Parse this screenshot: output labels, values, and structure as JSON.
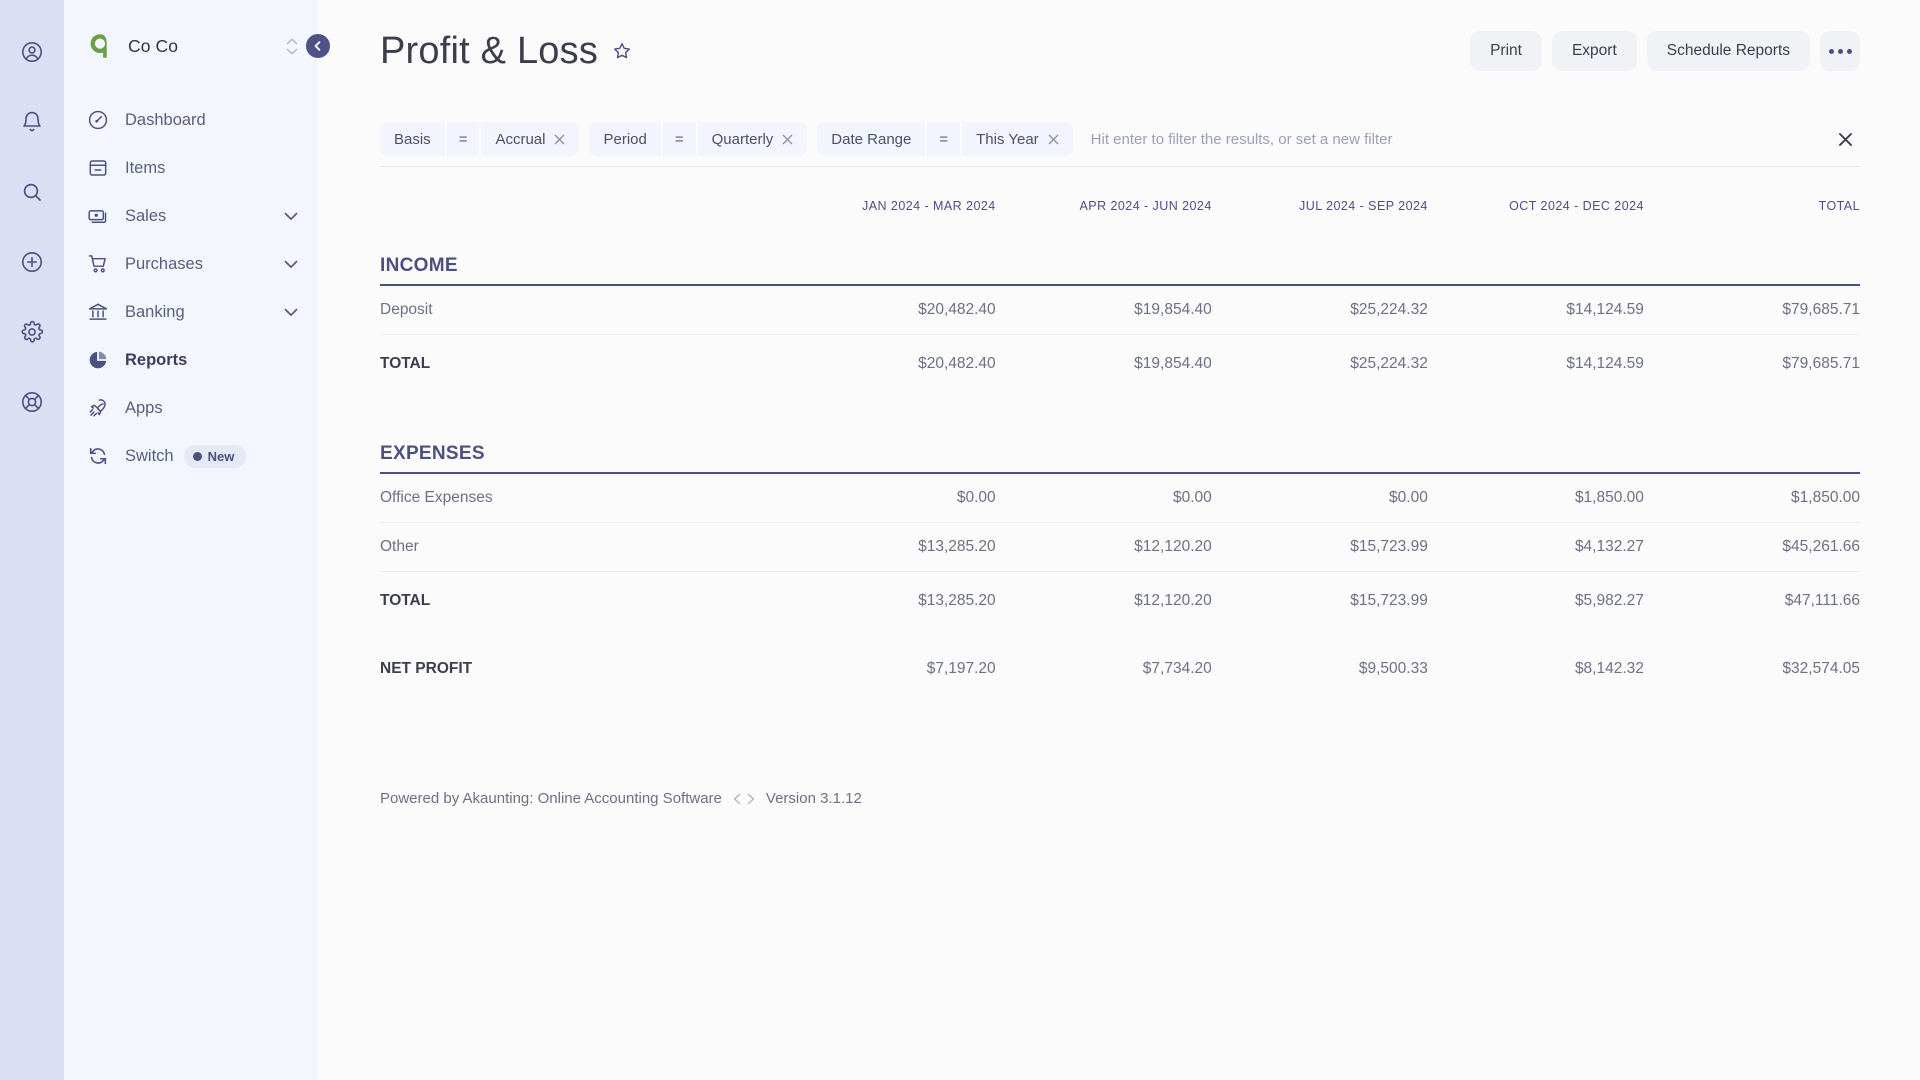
{
  "icon_rail": [
    {
      "name": "account-icon",
      "label": "Account"
    },
    {
      "name": "notifications-icon",
      "label": "Notifications"
    },
    {
      "name": "search-icon",
      "label": "Search"
    },
    {
      "name": "create-new-icon",
      "label": "Create New"
    },
    {
      "name": "settings-icon",
      "label": "Settings"
    },
    {
      "name": "help-icon",
      "label": "Help"
    }
  ],
  "sidebar": {
    "company_name": "Co Co",
    "logo_color": "#6a9f45",
    "items": [
      {
        "label": "Dashboard",
        "icon": "dashboard-icon",
        "expandable": false,
        "active": false
      },
      {
        "label": "Items",
        "icon": "items-icon",
        "expandable": false,
        "active": false
      },
      {
        "label": "Sales",
        "icon": "sales-icon",
        "expandable": true,
        "active": false
      },
      {
        "label": "Purchases",
        "icon": "purchases-icon",
        "expandable": true,
        "active": false
      },
      {
        "label": "Banking",
        "icon": "banking-icon",
        "expandable": true,
        "active": false
      },
      {
        "label": "Reports",
        "icon": "reports-icon",
        "expandable": false,
        "active": true
      },
      {
        "label": "Apps",
        "icon": "apps-icon",
        "expandable": false,
        "active": false
      },
      {
        "label": "Switch",
        "icon": "switch-icon",
        "expandable": false,
        "active": false,
        "badge": "New"
      }
    ]
  },
  "header": {
    "title": "Profit & Loss",
    "favorite_icon": "star-icon",
    "buttons": {
      "print": "Print",
      "export": "Export",
      "schedule_reports": "Schedule Reports",
      "more": "•••"
    }
  },
  "filters": {
    "chips": [
      {
        "field": "Basis",
        "operator": "=",
        "value": "Accrual"
      },
      {
        "field": "Period",
        "operator": "=",
        "value": "Quarterly"
      },
      {
        "field": "Date Range",
        "operator": "=",
        "value": "This Year"
      }
    ],
    "input_value": "",
    "placeholder": "Hit enter to filter the results, or set a new filter",
    "clear_label": "×"
  },
  "report": {
    "columns": [
      "",
      "JAN 2024 - MAR 2024",
      "APR 2024 - JUN 2024",
      "JUL 2024 - SEP 2024",
      "OCT 2024 - DEC 2024",
      "TOTAL"
    ],
    "sections": [
      {
        "title": "INCOME",
        "rows": [
          {
            "name": "Deposit",
            "values": [
              "$20,482.40",
              "$19,854.40",
              "$25,224.32",
              "$14,124.59",
              "$79,685.71"
            ]
          }
        ],
        "total": {
          "name": "TOTAL",
          "values": [
            "$20,482.40",
            "$19,854.40",
            "$25,224.32",
            "$14,124.59",
            "$79,685.71"
          ]
        }
      },
      {
        "title": "EXPENSES",
        "rows": [
          {
            "name": "Office Expenses",
            "values": [
              "$0.00",
              "$0.00",
              "$0.00",
              "$1,850.00",
              "$1,850.00"
            ]
          },
          {
            "name": "Other",
            "values": [
              "$13,285.20",
              "$12,120.20",
              "$15,723.99",
              "$4,132.27",
              "$45,261.66"
            ]
          }
        ],
        "total": {
          "name": "TOTAL",
          "values": [
            "$13,285.20",
            "$12,120.20",
            "$15,723.99",
            "$5,982.27",
            "$47,111.66"
          ]
        }
      }
    ],
    "net": {
      "name": "NET PROFIT",
      "values": [
        "$7,197.20",
        "$7,734.20",
        "$9,500.33",
        "$8,142.32",
        "$32,574.05"
      ]
    }
  },
  "footer": {
    "powered_by": "Powered by Akaunting: Online Accounting Software",
    "version": "Version 3.1.12"
  },
  "colors": {
    "accent": "#4b5081",
    "rail_bg": "#dcdff4",
    "sidebar_bg": "#f4f6fd",
    "chip_bg": "#f2f5fe",
    "page_bg": "#fbfbfc"
  }
}
